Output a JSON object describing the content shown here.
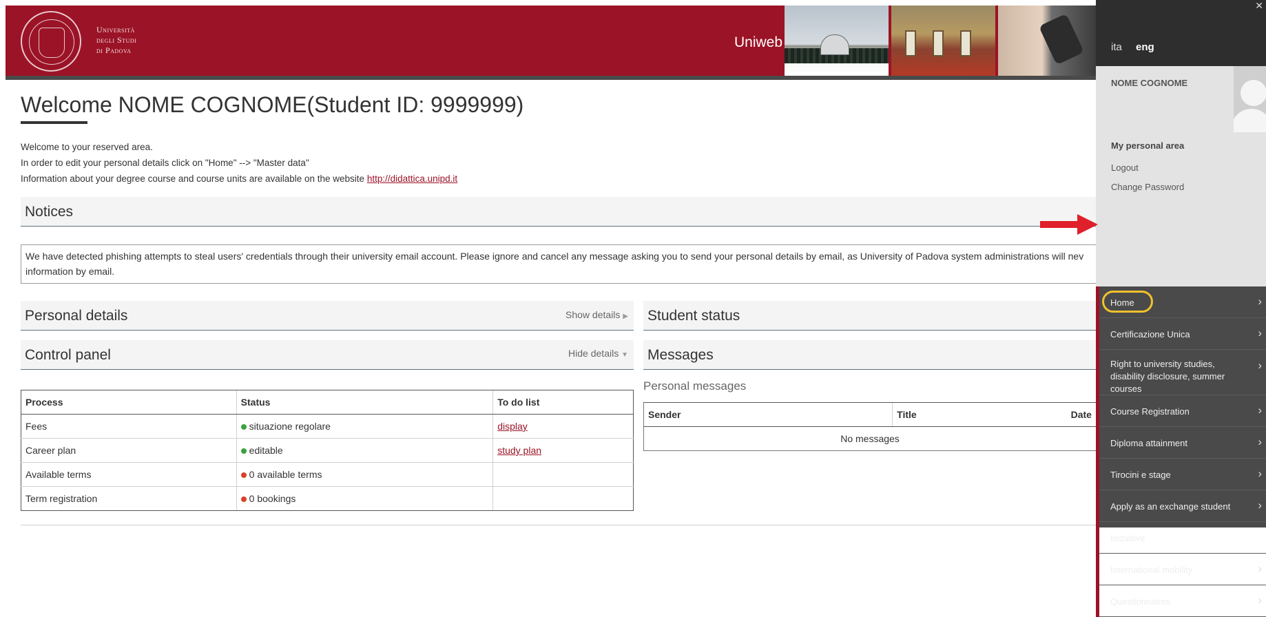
{
  "header": {
    "university_line1": "Università",
    "university_line2": "degli Studi",
    "university_line3": "di Padova",
    "app_title": "Uniweb"
  },
  "welcome": {
    "title": "Welcome  NOME COGNOME(Student ID: 9999999)",
    "line1": "Welcome to your reserved area.",
    "line2": "In order to edit your personal details click on \"Home\" --> \"Master data\"",
    "line3_prefix": "Information about your degree course and course units are available on the website ",
    "link": "http://didattica.unipd.it"
  },
  "notices": {
    "title": "Notices",
    "text": "We have detected phishing attempts to steal users' credentials through their university email account. Please ignore and cancel any message asking you to send your personal details by email, as University of Padova system administrations will nev information by email."
  },
  "personal_details": {
    "title": "Personal details",
    "action": "Show details"
  },
  "student_status": {
    "title": "Student status"
  },
  "control_panel": {
    "title": "Control panel",
    "action": "Hide details",
    "headers": [
      "Process",
      "Status",
      "To do list"
    ],
    "rows": [
      {
        "process": "Fees",
        "status": "situazione regolare",
        "status_color": "#3aa23a",
        "todo": "display"
      },
      {
        "process": "Career plan",
        "status": "editable",
        "status_color": "#3aa23a",
        "todo": "study plan"
      },
      {
        "process": "Available terms",
        "status": "0 available terms",
        "status_color": "#d9412b",
        "todo": ""
      },
      {
        "process": "Term registration",
        "status": "0 bookings",
        "status_color": "#d9412b",
        "todo": ""
      }
    ]
  },
  "messages": {
    "title": "Messages",
    "subtitle": "Personal messages",
    "headers": [
      "Sender",
      "Title",
      "Date"
    ],
    "empty": "No messages"
  },
  "sidebar": {
    "lang_ita": "ita",
    "lang_eng": "eng",
    "user_name": "NOME COGNOME",
    "personal_area": "My personal area",
    "logout": "Logout",
    "change_password": "Change Password",
    "menu": [
      "Home",
      "Certificazione Unica",
      "Right to university studies, disability disclosure, summer courses",
      "Course Registration",
      "Diploma attainment",
      "Tirocini e stage",
      "Apply as an exchange student",
      "Iniziative",
      "International mobility",
      "Questionnaires"
    ]
  },
  "colors": {
    "brand": "#9b1326",
    "annotation_arrow": "#e0202a",
    "annotation_ring": "#f2c12e"
  }
}
